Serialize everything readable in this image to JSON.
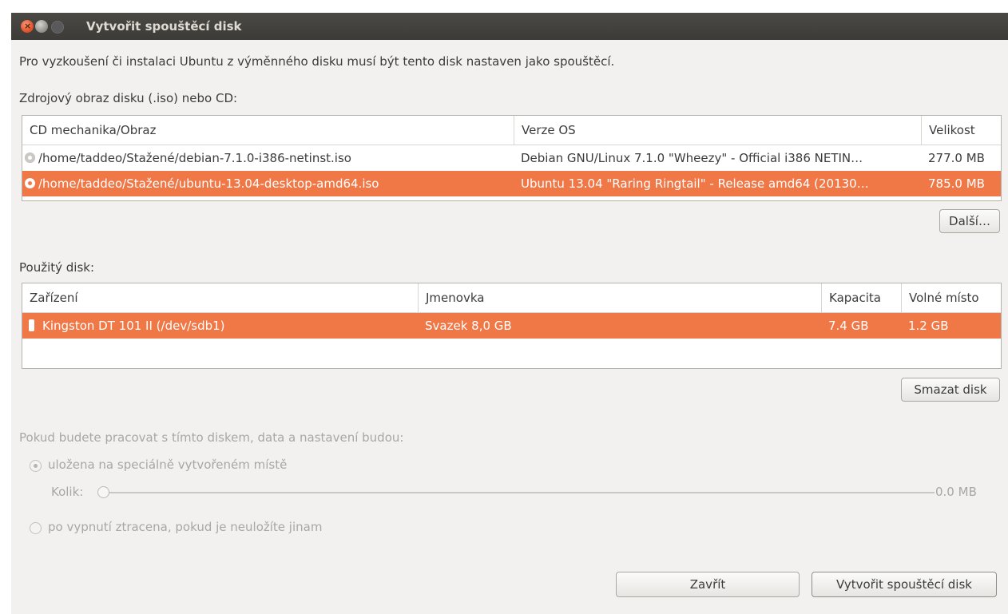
{
  "window": {
    "title": "Vytvořit spouštěcí disk",
    "accent": "#f07746"
  },
  "intro": "Pro vyzkoušení či instalaci Ubuntu z výměnného disku musí být tento disk nastaven jako spouštěcí.",
  "source": {
    "label": "Zdrojový obraz disku (.iso) nebo CD:",
    "columns": [
      "CD mechanika/Obraz",
      "Verze OS",
      "Velikost"
    ],
    "rows": [
      {
        "icon": "disc-icon",
        "path": "/home/taddeo/Stažené/debian-7.1.0-i386-netinst.iso",
        "os": "Debian GNU/Linux 7.1.0 \"Wheezy\" - Official i386 NETIN…",
        "size": "277.0 MB",
        "selected": false
      },
      {
        "icon": "disc-icon",
        "path": "/home/taddeo/Stažené/ubuntu-13.04-desktop-amd64.iso",
        "os": "Ubuntu 13.04 \"Raring Ringtail\" - Release amd64 (20130…",
        "size": "785.0 MB",
        "selected": true
      }
    ],
    "other_button": "Další…"
  },
  "target": {
    "label": "Použitý disk:",
    "columns": [
      "Zařízení",
      "Jmenovka",
      "Kapacita",
      "Volné místo"
    ],
    "rows": [
      {
        "icon": "usb-drive-icon",
        "device": "Kingston DT 101 II (/dev/sdb1)",
        "label": "Svazek 8,0 GB",
        "capacity": "7.4 GB",
        "free": "1.2 GB",
        "selected": true
      }
    ],
    "erase_button": "Smazat disk"
  },
  "persistence": {
    "label": "Pokud budete pracovat s tímto diskem, data a nastavení budou:",
    "option_store": "uložena na speciálně vytvořeném místě",
    "how_much_label": "Kolik:",
    "slider_value": "0.0 MB",
    "slider_fraction": 0,
    "option_discard": "po vypnutí ztracena, pokud je neuložíte jinam",
    "selected_option": "store",
    "enabled": false
  },
  "buttons": {
    "close": "Zavřít",
    "make": "Vytvořit spouštěcí disk"
  }
}
